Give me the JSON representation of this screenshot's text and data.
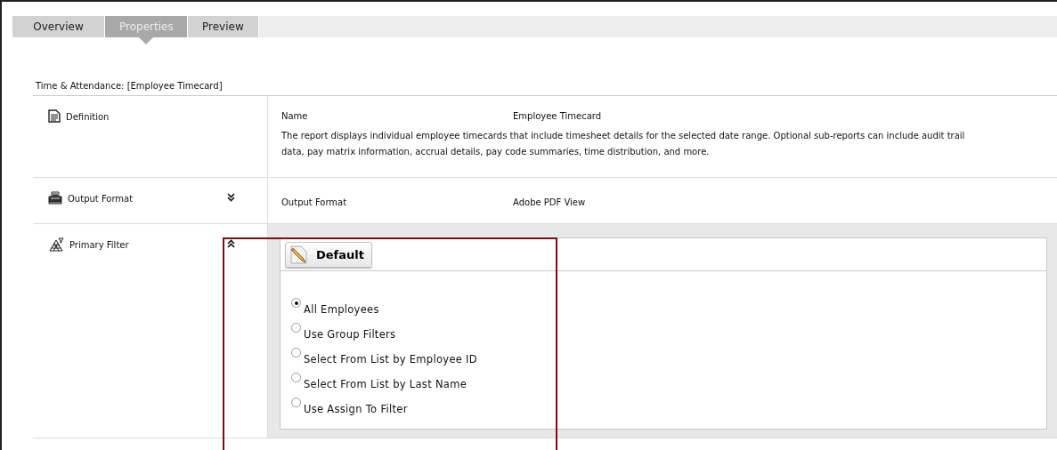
{
  "tabs": [
    {
      "label": "Overview",
      "selected": false
    },
    {
      "label": "Properties",
      "selected": true
    },
    {
      "label": "Preview",
      "selected": false
    }
  ],
  "heading": "Time & Attendance: [Employee Timecard]",
  "sections": [
    {
      "kind": "definition",
      "label": "Definition",
      "name_label": "Name",
      "name_value": "Employee Timecard",
      "description": "The report displays individual employee timecards that include timesheet details for the selected date range. Optional sub-reports can include audit trail data, pay matrix information, accrual details, pay code summaries, time distribution, and more."
    },
    {
      "kind": "output",
      "label": "Output Format",
      "expanded": false,
      "field_label": "Output Format",
      "field_value": "Adobe PDF View"
    },
    {
      "kind": "filter",
      "label": "Primary Filter",
      "expanded": true,
      "button": "Default",
      "options": [
        {
          "label": "All Employees",
          "selected": true
        },
        {
          "label": "Use Group Filters",
          "selected": false
        },
        {
          "label": "Select From List by Employee ID",
          "selected": false
        },
        {
          "label": "Select From List by Last Name",
          "selected": false
        },
        {
          "label": "Use Assign To Filter",
          "selected": false
        }
      ]
    }
  ]
}
